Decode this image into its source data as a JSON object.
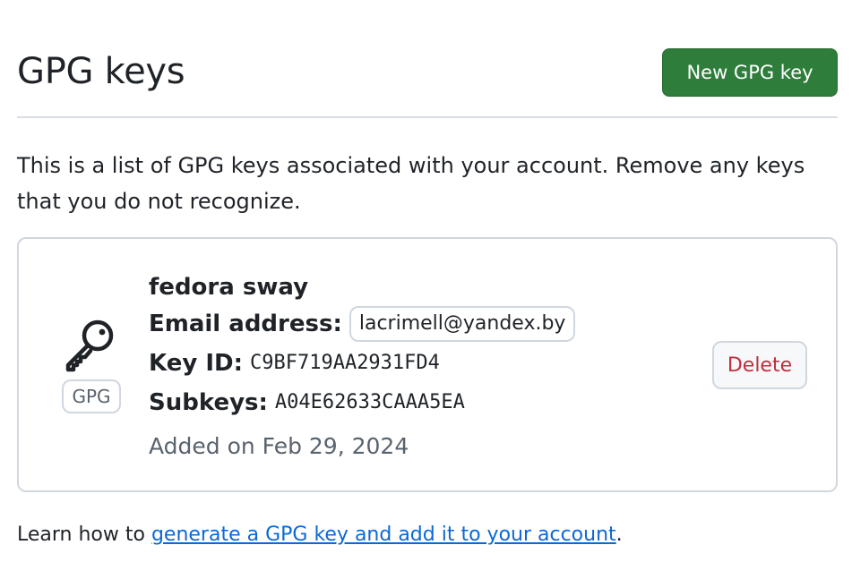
{
  "header": {
    "title": "GPG keys",
    "new_button_label": "New GPG key"
  },
  "description": "This is a list of GPG keys associated with your account. Remove any keys that you do not recognize.",
  "keys": [
    {
      "icon": "key-icon",
      "type_label": "GPG",
      "name": "fedora sway",
      "email_label": "Email address:",
      "email": "lacrimell@yandex.by",
      "key_id_label": "Key ID:",
      "key_id": "C9BF719AA2931FD4",
      "subkeys_label": "Subkeys:",
      "subkeys": "A04E62633CAAA5EA",
      "added": "Added on Feb 29, 2024",
      "delete_label": "Delete"
    }
  ],
  "footer": {
    "prefix": "Learn how to ",
    "link_text": "generate a GPG key and add it to your account",
    "suffix": "."
  },
  "colors": {
    "primary_button": "#2f7d3b",
    "danger_text": "#c0303d",
    "link": "#0969da"
  }
}
